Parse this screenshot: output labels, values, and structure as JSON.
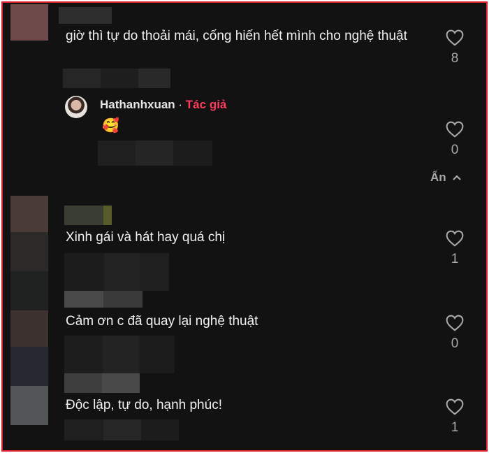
{
  "comments": [
    {
      "text": "giờ thì tự do thoải mái, cống hiến hết mình cho nghệ thuật",
      "likes": "8"
    },
    {
      "author": "Hathanhxuan",
      "separator": " · ",
      "author_tag": "Tác giả",
      "text": "🥰",
      "likes": "0"
    },
    {
      "text": "Xinh gái và hát hay quá chị",
      "likes": "1"
    },
    {
      "text": "Cảm ơn c đã quay lại nghệ thuật",
      "likes": "0"
    },
    {
      "text": "Độc lập, tự do, hạnh phúc!",
      "likes": "1"
    }
  ],
  "replies_toggle": {
    "label": "Ẩn"
  },
  "colors": {
    "background": "#121212",
    "author_tag": "#ff3b5c",
    "text": "#f1f1f1",
    "muted": "#a8a8a8"
  }
}
